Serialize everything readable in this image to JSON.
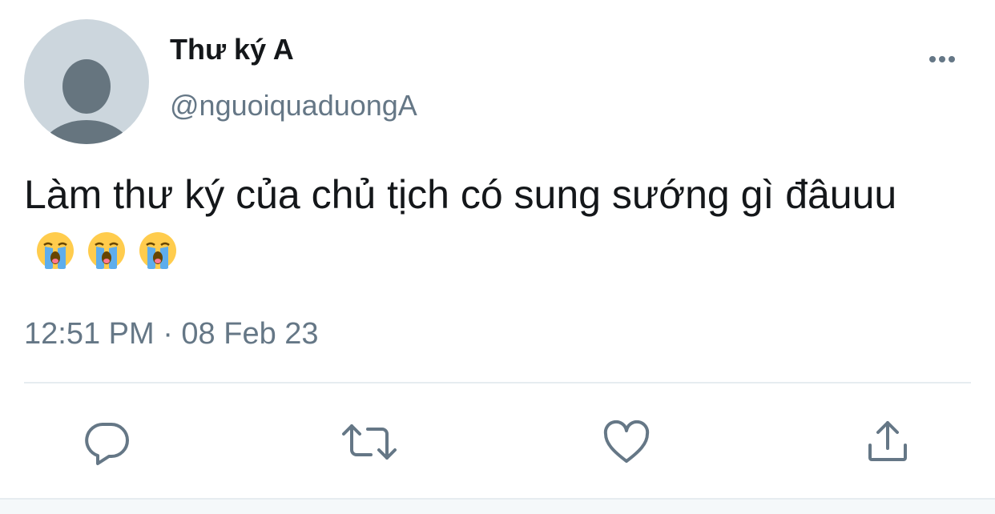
{
  "user": {
    "display_name": "Thư ký A",
    "handle": "@nguoiquaduongA",
    "avatar_icon": "default-avatar-icon"
  },
  "tweet": {
    "text": "Làm thư ký của chủ tịch có sung sướng gì đâuuu",
    "emoji": [
      "loudly-crying-face",
      "loudly-crying-face",
      "loudly-crying-face"
    ],
    "timestamp": "12:51 PM · 08 Feb 23"
  },
  "actions": {
    "reply_icon": "reply-icon",
    "retweet_icon": "retweet-icon",
    "like_icon": "heart-icon",
    "share_icon": "share-icon",
    "more_icon": "more-icon"
  },
  "colors": {
    "primary_text": "#14171a",
    "secondary_text": "#657786",
    "avatar_bg": "#ccd6dd",
    "avatar_figure": "#66757f",
    "divider": "#e6ecf0"
  }
}
